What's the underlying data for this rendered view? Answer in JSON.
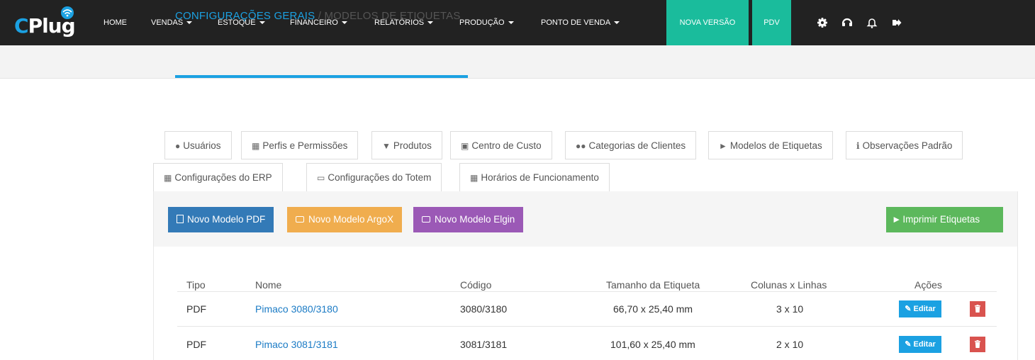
{
  "brand": {
    "logo_text_c": "C",
    "logo_text_rest": "Plug"
  },
  "nav": {
    "home": "HOME",
    "vendas": "VENDAS",
    "estoque": "ESTOQUE",
    "financeiro": "FINANCEIRO",
    "relatorios": "RELATÓRIOS",
    "producao": "PRODUÇÃO",
    "ponto_de_venda": "PONTO DE VENDA",
    "nova_versao": "NOVA VERSÃO",
    "pdv": "PDV",
    "icons": [
      "gear-icon",
      "headset-icon",
      "bell-icon",
      "logout-icon"
    ],
    "accent_color": "#1abc9c"
  },
  "breadcrumb": {
    "parent": "CONFIGURAÇÕES GERAIS",
    "separator": " / ",
    "current": "MODELOS DE ETIQUETAS",
    "accent_color": "#1ba1e2"
  },
  "tabs": [
    {
      "icon": "user-icon",
      "label": "Usuários"
    },
    {
      "icon": "table-icon",
      "label": "Perfis e Permissões"
    },
    {
      "icon": "cart-icon",
      "label": "Produtos"
    },
    {
      "icon": "briefcase-icon",
      "label": "Centro de Custo"
    },
    {
      "icon": "users-icon",
      "label": "Categorias de Clientes"
    },
    {
      "icon": "tags-icon",
      "label": "Modelos de Etiquetas"
    },
    {
      "icon": "info-icon",
      "label": "Observações Padrão"
    },
    {
      "icon": "table-icon",
      "label": "Configurações do ERP"
    },
    {
      "icon": "monitor-icon",
      "label": "Configurações do Totem"
    },
    {
      "icon": "calendar-icon",
      "label": "Horários de Funcionamento"
    }
  ],
  "actions": {
    "novo_pdf": "Novo Modelo PDF",
    "novo_argox": "Novo Modelo ArgoX",
    "novo_elgin": "Novo Modelo Elgin",
    "imprimir": "Imprimir Etiquetas"
  },
  "table": {
    "headers": {
      "tipo": "Tipo",
      "nome": "Nome",
      "codigo": "Código",
      "tamanho": "Tamanho da Etiqueta",
      "colunas": "Colunas x Linhas",
      "acoes": "Ações"
    },
    "edit_label": "Editar",
    "rows": [
      {
        "tipo": "PDF",
        "nome": "Pimaco 3080/3180",
        "codigo": "3080/3180",
        "tamanho": "66,70 x 25,40 mm",
        "colunas": "3 x 10"
      },
      {
        "tipo": "PDF",
        "nome": "Pimaco 3081/3181",
        "codigo": "3081/3181",
        "tamanho": "101,60 x 25,40 mm",
        "colunas": "2 x 10"
      }
    ]
  }
}
